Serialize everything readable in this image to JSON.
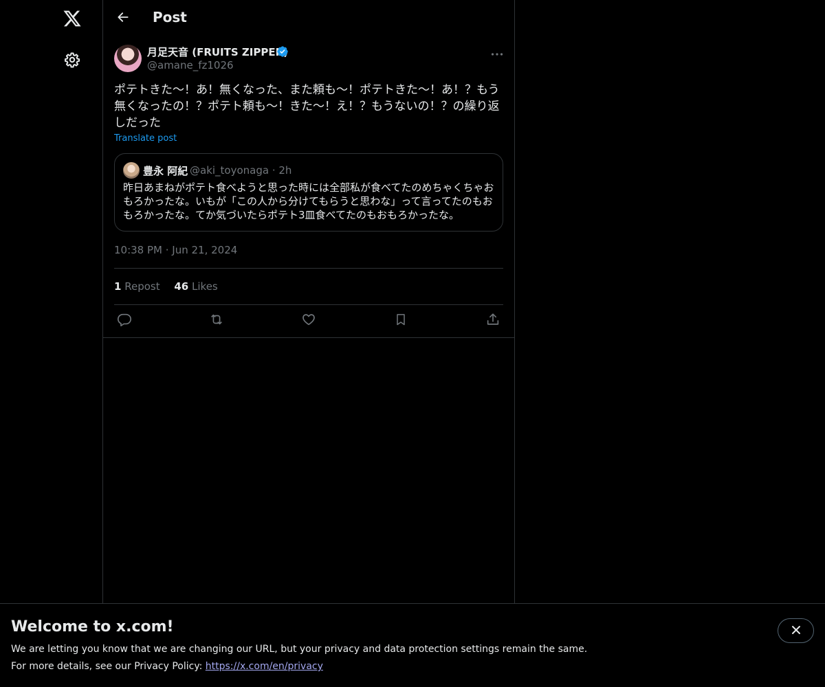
{
  "header": {
    "title": "Post"
  },
  "post": {
    "author_name": "月足天音 (FRUITS ZIPPER)",
    "author_handle": "@amane_fz1026",
    "text": "ポテトきた〜！あ！無くなった、また頼も〜！ポテトきた〜！あ！？もう無くなったの！？ポテト頼も〜！きた〜！え！？もうないの！？の繰り返しだった",
    "translate_label": "Translate post",
    "time": "10:38 PM",
    "date": "Jun 21, 2024",
    "repost_count": "1",
    "repost_label": "Repost",
    "like_count": "46",
    "like_label": "Likes"
  },
  "quote": {
    "author_name": "豊永 阿紀",
    "author_handle": "@aki_toyonaga",
    "age": "2h",
    "text": "昨日あまねがポテト食べようと思った時には全部私が食べてたのめちゃくちゃおもろかったな。いもが「この人から分けてもらうと思わな」って言ってたのもおもろかったな。てか気づいたらポテト3皿食べてたのもおもろかったな。"
  },
  "banner": {
    "title": "Welcome to x.com!",
    "line1": "We are letting you know that we are changing our URL, but your privacy and data protection settings remain the same.",
    "line2_prefix": "For more details, see our Privacy Policy: ",
    "link": "https://x.com/en/privacy"
  },
  "icons": {
    "logo": "x-logo-icon",
    "settings": "gear-icon",
    "back": "arrow-left-icon",
    "verified": "verified-badge-icon",
    "more": "more-horizontal-icon",
    "reply": "reply-icon",
    "repost": "repost-icon",
    "like": "heart-icon",
    "bookmark": "bookmark-icon",
    "share": "share-icon",
    "close": "close-icon"
  },
  "colors": {
    "background": "#000000",
    "text": "#e7e9ea",
    "muted": "#71767b",
    "accent": "#1d9bf0",
    "border": "#2f3336",
    "link": "#a4a8f0"
  }
}
